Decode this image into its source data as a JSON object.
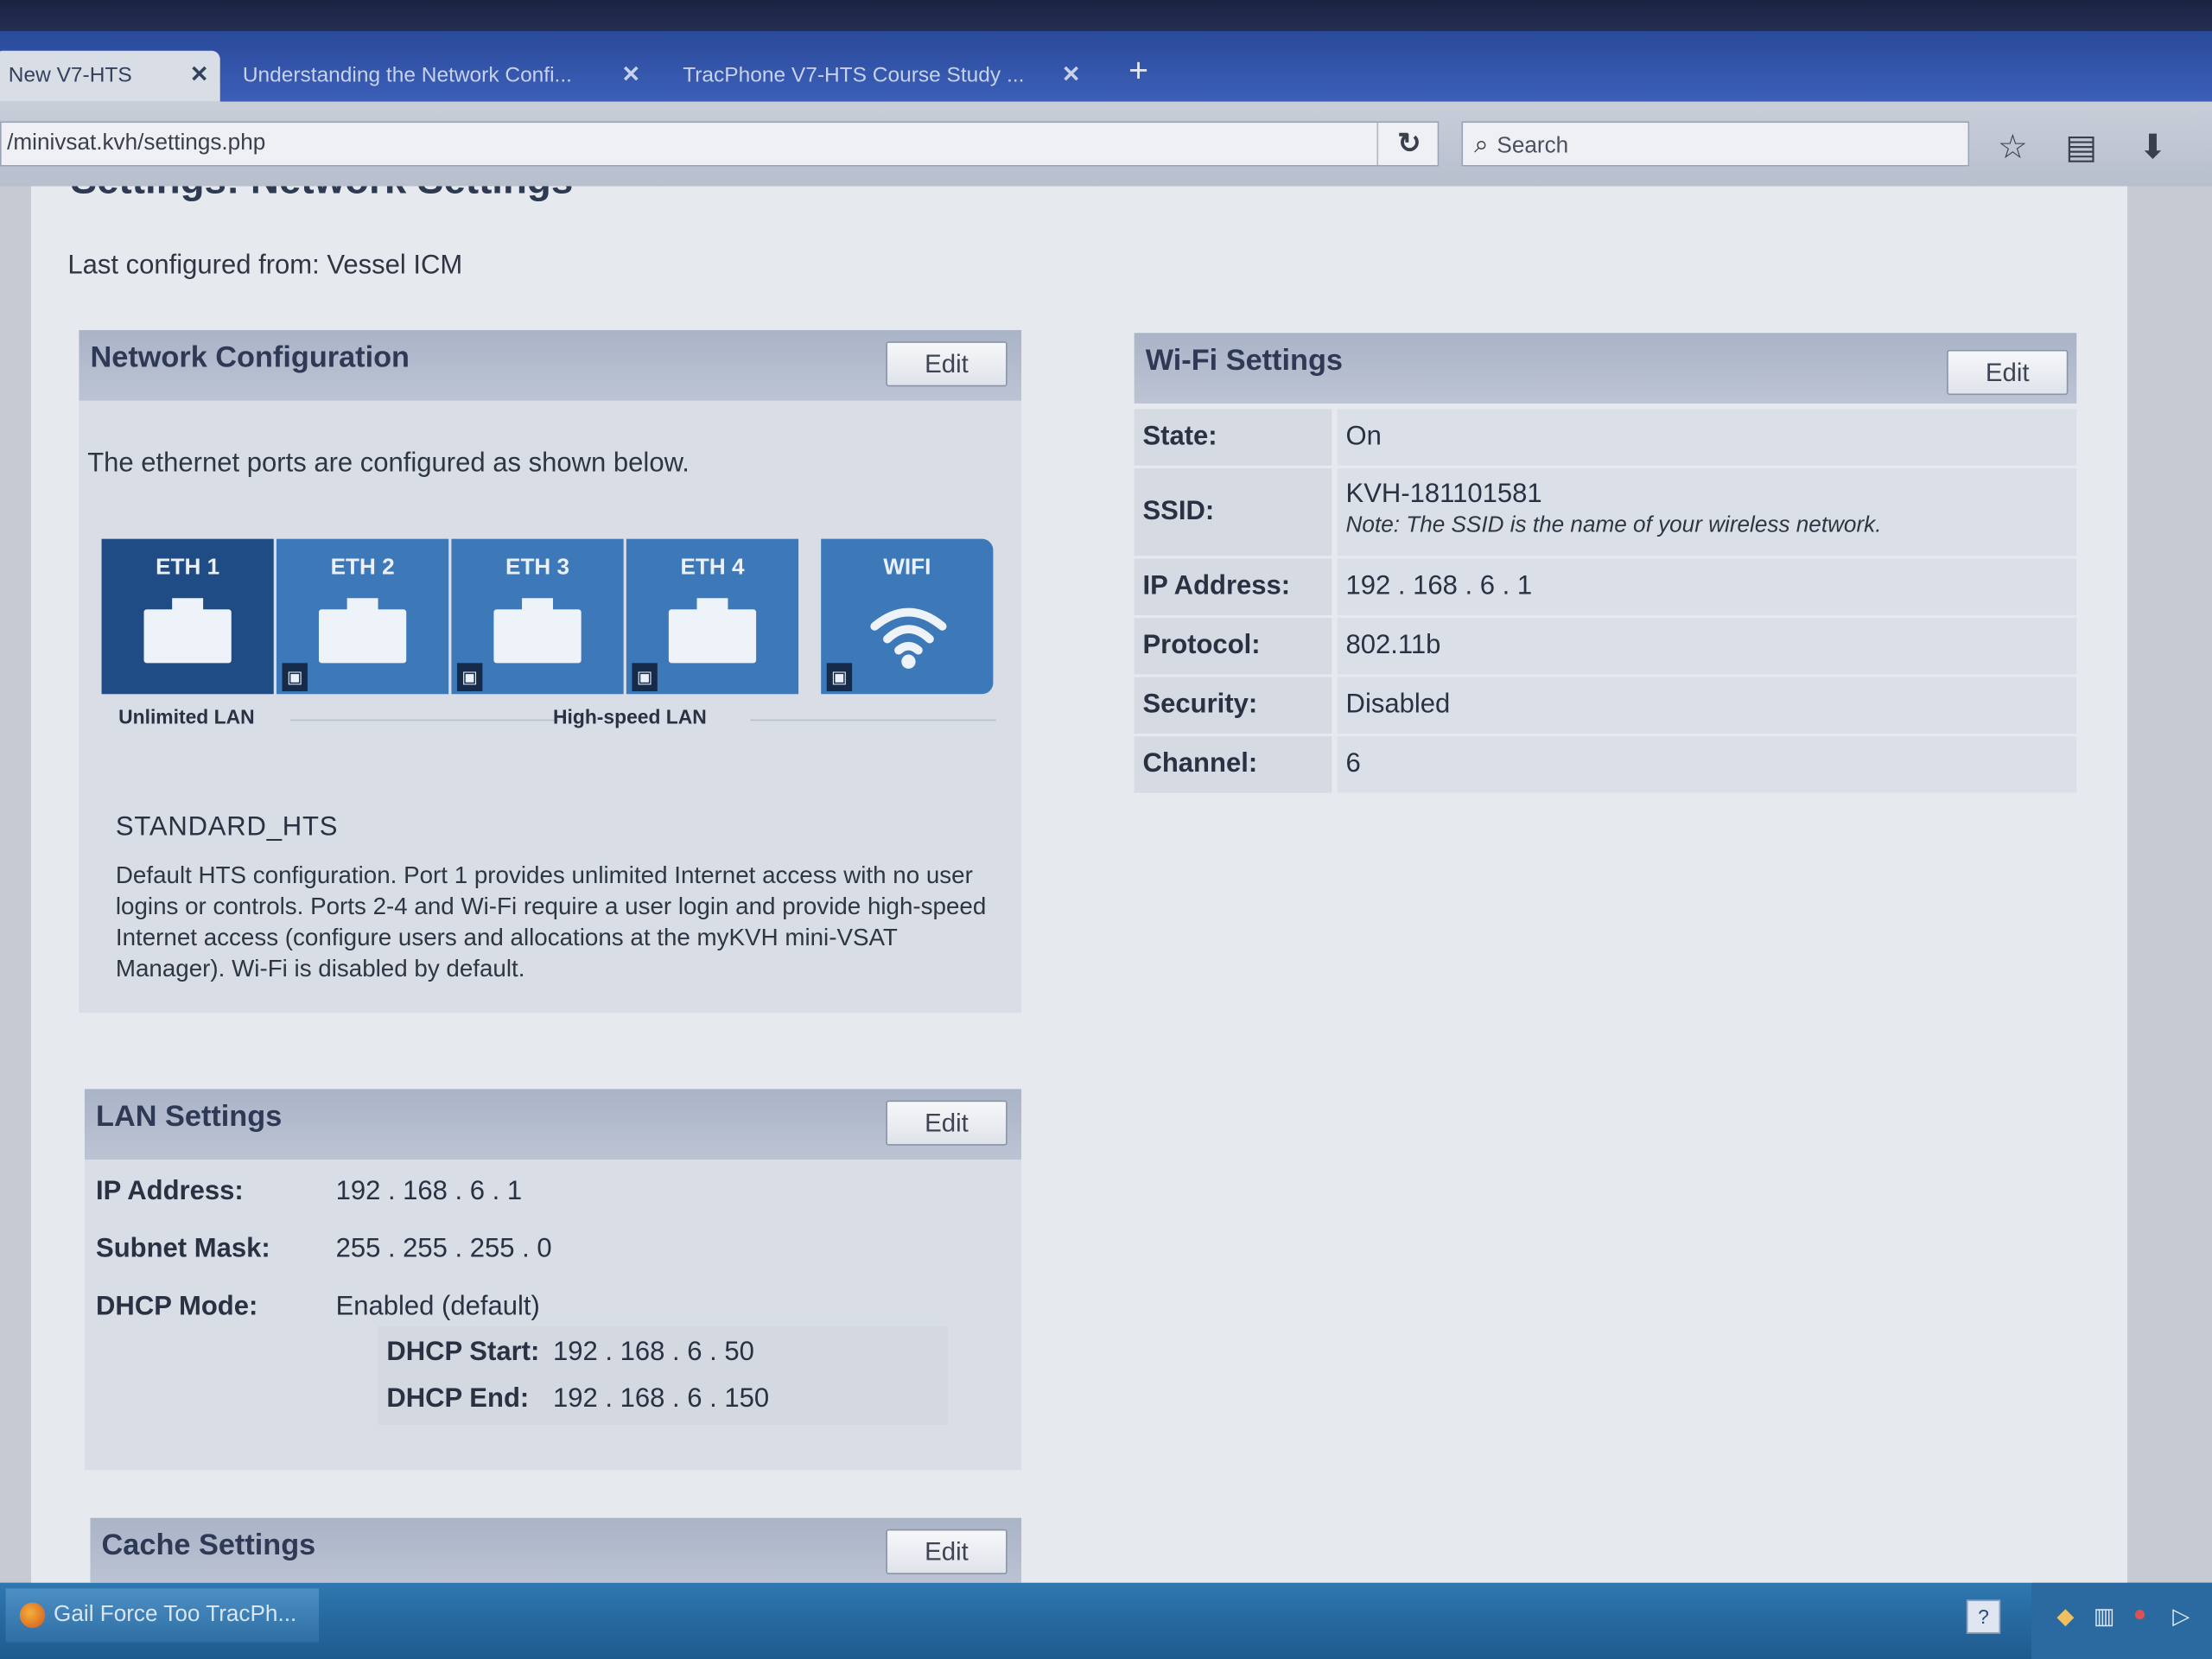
{
  "browser": {
    "tabs": [
      {
        "label": "New V7-HTS",
        "active": true
      },
      {
        "label": "Understanding the Network Confi...",
        "active": false
      },
      {
        "label": "TracPhone V7-HTS Course Study ...",
        "active": false
      }
    ],
    "new_tab_label": "+",
    "tab_close": "✕",
    "url": "/minivsat.kvh/settings.php",
    "search_placeholder": "Search"
  },
  "page": {
    "title": "Settings: Network Settings",
    "last_configured": "Last configured from: Vessel ICM"
  },
  "network_config": {
    "title": "Network Configuration",
    "edit_label": "Edit",
    "intro": "The ethernet ports are configured as shown below.",
    "ports": [
      {
        "label": "ETH 1",
        "locked": false
      },
      {
        "label": "ETH 2",
        "locked": true
      },
      {
        "label": "ETH 3",
        "locked": true
      },
      {
        "label": "ETH 4",
        "locked": true
      },
      {
        "label": "WIFI",
        "locked": true
      }
    ],
    "caption_unlimited": "Unlimited LAN",
    "caption_highspeed": "High-speed LAN",
    "config_name": "STANDARD_HTS",
    "config_description": "Default HTS configuration. Port 1 provides unlimited Internet access with no user logins or controls. Ports 2-4 and Wi-Fi require a user login and provide high-speed Internet access (configure users and allocations at the myKVH mini-VSAT Manager). Wi-Fi is disabled by default."
  },
  "wifi": {
    "title": "Wi-Fi Settings",
    "edit_label": "Edit",
    "rows": [
      {
        "key": "State:",
        "value": "On"
      },
      {
        "key": "SSID:",
        "value": "KVH-181101581",
        "note": "Note: The SSID is the name of your wireless network."
      },
      {
        "key": "IP Address:",
        "value": "192 . 168 . 6 . 1"
      },
      {
        "key": "Protocol:",
        "value": "802.11b"
      },
      {
        "key": "Security:",
        "value": "Disabled"
      },
      {
        "key": "Channel:",
        "value": "6"
      }
    ]
  },
  "lan": {
    "title": "LAN Settings",
    "edit_label": "Edit",
    "ip_label": "IP Address:",
    "ip_value": "192 . 168 . 6 . 1",
    "mask_label": "Subnet Mask:",
    "mask_value": "255 . 255 . 255 . 0",
    "dhcp_label": "DHCP Mode:",
    "dhcp_value": "Enabled (default)",
    "dhcp_start_label": "DHCP Start:",
    "dhcp_start_value": "192 . 168 . 6 . 50",
    "dhcp_end_label": "DHCP End:",
    "dhcp_end_value": "192 . 168 . 6 . 150"
  },
  "cache": {
    "title": "Cache Settings",
    "edit_label": "Edit"
  },
  "taskbar": {
    "item_label": "Gail Force Too TracPh...",
    "help_label": "?"
  },
  "colors": {
    "port_dark": "#1f4c85",
    "port_light": "#3d78b8",
    "panel_header": "#aab4c7"
  }
}
